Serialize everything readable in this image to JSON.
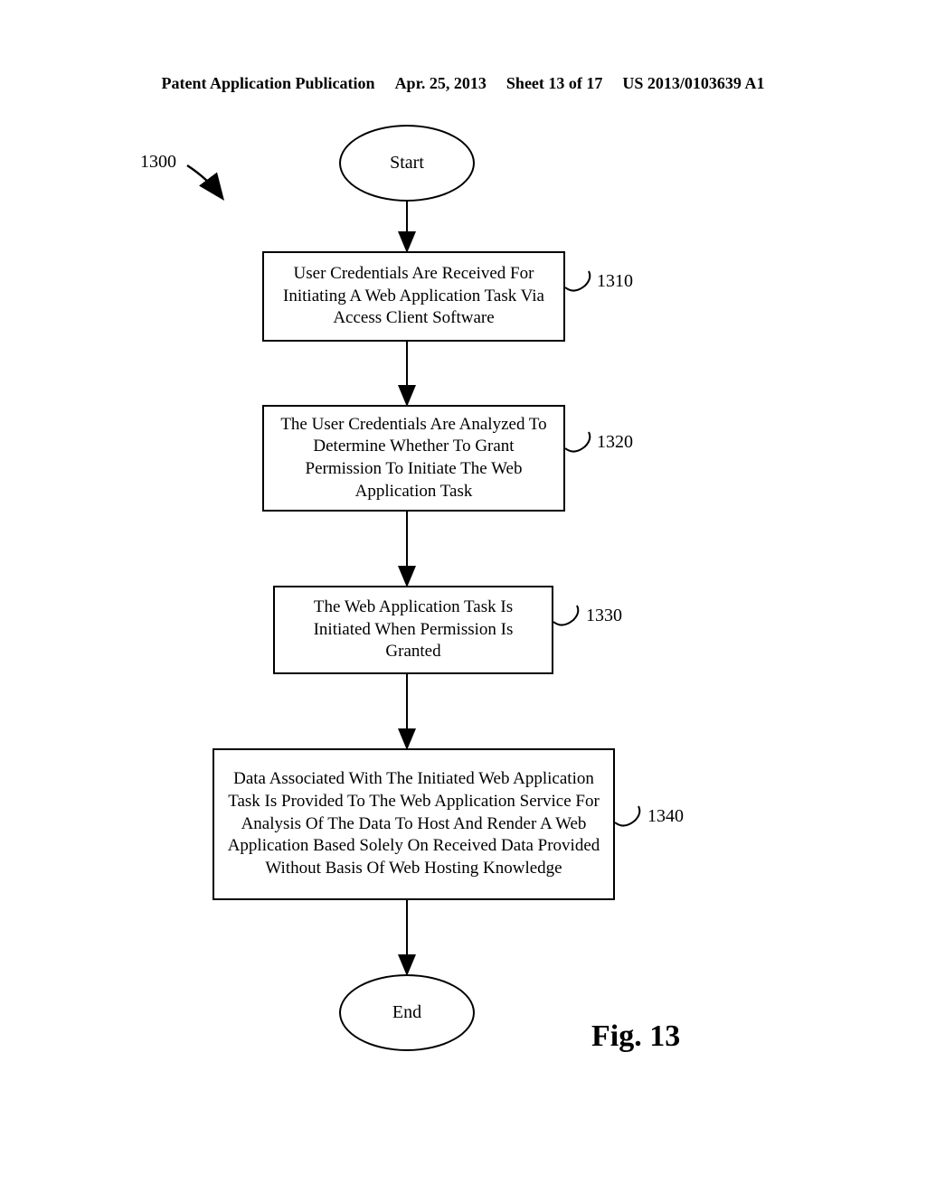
{
  "header": {
    "pub": "Patent Application Publication",
    "date": "Apr. 25, 2013",
    "sheet": "Sheet 13 of 17",
    "docnum": "US 2013/0103639 A1"
  },
  "diagram": {
    "ref_main": "1300",
    "start": "Start",
    "end": "End",
    "figure_label": "Fig. 13",
    "steps": [
      {
        "ref": "1310",
        "text": "User Credentials Are Received For Initiating A Web Application Task Via Access Client Software"
      },
      {
        "ref": "1320",
        "text": "The User Credentials Are Analyzed To Determine Whether To Grant Permission To Initiate The Web Application Task"
      },
      {
        "ref": "1330",
        "text": "The Web Application Task Is Initiated When Permission Is Granted"
      },
      {
        "ref": "1340",
        "text": "Data Associated With The Initiated Web Application Task Is Provided To The Web Application Service For Analysis Of The Data To Host And Render A Web Application Based Solely On Received Data Provided Without Basis Of Web Hosting Knowledge"
      }
    ]
  }
}
